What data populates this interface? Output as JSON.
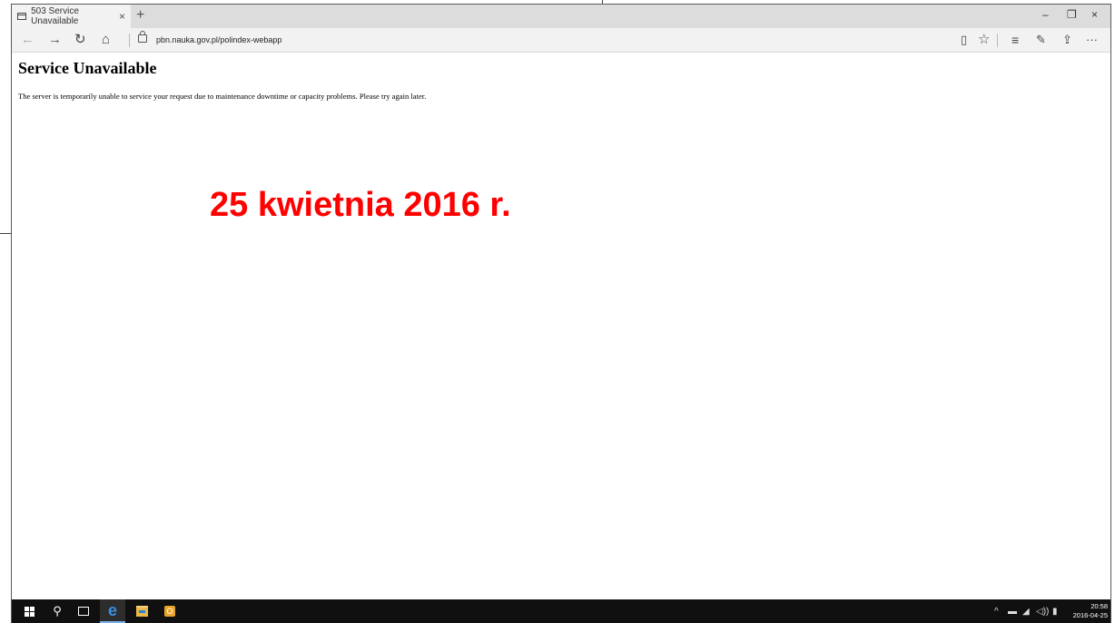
{
  "browser": {
    "tab_title": "503 Service Unavailable",
    "tab_close": "×",
    "new_tab": "+",
    "window_controls": {
      "minimize": "–",
      "restore": "❐",
      "close": "×"
    },
    "nav_icons": {
      "back": "←",
      "forward": "→",
      "refresh": "↻",
      "home": "⌂",
      "reading_view": "▯",
      "favorites": "☆",
      "hub": "≡",
      "web_note": "✎",
      "share": "⇪",
      "more": "···"
    },
    "url": "pbn.nauka.gov.pl/polindex-webapp"
  },
  "page": {
    "heading": "Service Unavailable",
    "message": "The server is temporarily unable to service your request due to maintenance downtime or capacity problems. Please try again later."
  },
  "annotation": {
    "text": "25 kwietnia 2016 r.",
    "color": "#ff0000"
  },
  "taskbar": {
    "search_icon": "⚲",
    "edge_icon": "e",
    "outlook_icon": "O",
    "tray": {
      "chevron": "^",
      "network": "▬",
      "wifi": "◢",
      "volume": "◁))",
      "action_center": "▮"
    },
    "clock": {
      "time": "20:58",
      "date": "2016-04-25"
    }
  }
}
